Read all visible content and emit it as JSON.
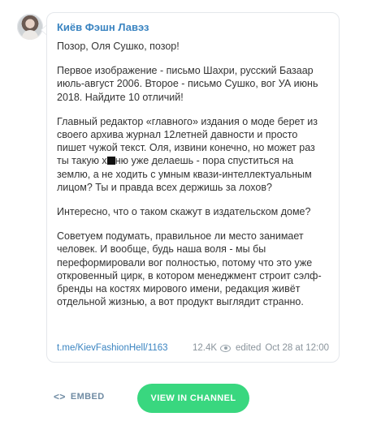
{
  "post": {
    "channel_name": "Киёв Фэшн Лавэз",
    "paragraphs": [
      "Позор, Оля Сушко, позор!",
      "Первое изображение - письмо Шахри, русский Базаар июль-август 2006. Второе - письмо Сушко, вог УА июнь 2018. Найдите 10 отличий!",
      "Главный редактор «главного» издания о моде берет из своего архива журнал 12летней давности и просто пишет чужой текст. Оля, извини конечно, но может раз ты такую х",
      "Интересно, что о таком скажут в издательском доме?",
      "Советуем подумать, правильное ли место занимает человек. И вообще, будь наша воля - мы бы переформировали вог полностью, потому что это уже откровенный цирк, в котором менеджмент строит сэлф-бренды на костях мирового имени, редакция живёт отдельной жизнью, а вот продукт выглядит странно."
    ],
    "para3_after_censor": "ню уже делаешь - пора спуститься на землю, а не ходить с умным квази-интеллектуальным лицом? Ты и правда всех держишь за лохов?",
    "link": "t.me/KievFashionHell/1163",
    "views": "12.4K",
    "edited_label": "edited",
    "date": "Oct 28 at 12:00"
  },
  "actions": {
    "embed_label": "EMBED",
    "view_in_channel_label": "VIEW IN CHANNEL"
  },
  "colors": {
    "accent_link": "#3a84c1",
    "button_green": "#39d77f",
    "text": "#333333",
    "meta": "#8a949c"
  },
  "icons": {
    "views": "eye-icon",
    "embed": "code-icon"
  }
}
